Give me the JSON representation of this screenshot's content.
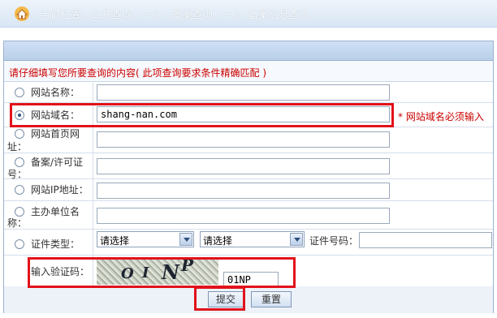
{
  "breadcrumb": {
    "prefix": "当前位置：公共查询",
    "sep1": "－＞",
    "level2": "备案查询",
    "sep2": "－＞",
    "level3": "备案信息查询"
  },
  "form": {
    "instruction": "请仔细填写您所要查询的内容( 此项查询要求条件精确匹配 )",
    "site_name_label": "网站名称：",
    "domain_label": "网站域名：",
    "domain_value": "shang-nan.com",
    "domain_required": "* 网站域名必须输入",
    "homepage_label_1": "网站首页网",
    "homepage_label_2": "址：",
    "license_label_1": "备案/许可证",
    "license_label_2": "号：",
    "ip_label": "网站IP地址：",
    "org_label_1": "主办单位名",
    "org_label_2": "称：",
    "cert_type_label": "证件类型：",
    "cert_select_1": "请选择",
    "cert_select_2": "请选择",
    "cert_number_label": "证件号码：",
    "captcha_label": "输入验证码：",
    "captcha_image_text": "OINP",
    "captcha_value": "01NP",
    "selected_option": "domain"
  },
  "buttons": {
    "submit": "提交",
    "reset": "重置"
  },
  "colors": {
    "highlight": "#e2121b",
    "warning": "#cc0000"
  }
}
